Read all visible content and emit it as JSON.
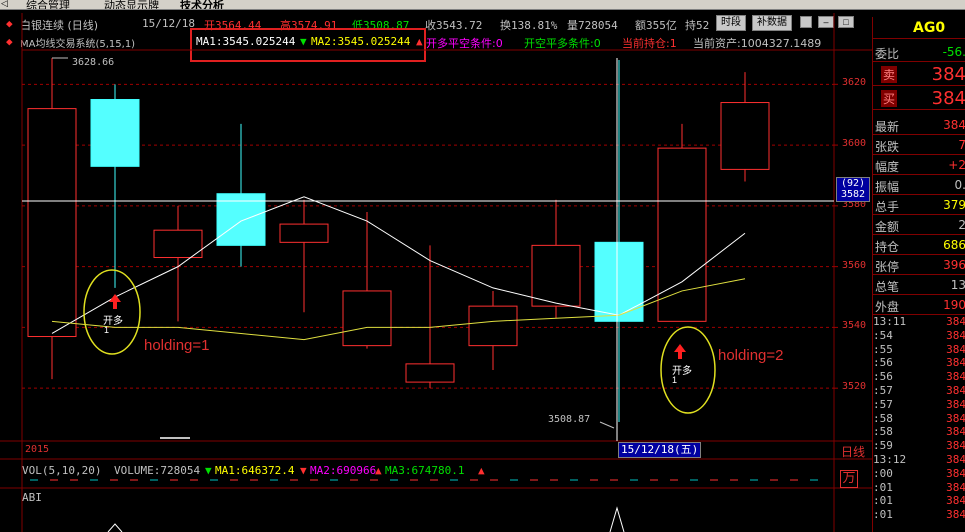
{
  "tabs": {
    "arrow": "◁",
    "items": [
      "综合管理",
      "动态显示牌",
      "技术分析"
    ],
    "active": 2
  },
  "header": {
    "title": "白银连续 (日线)",
    "date": "15/12/18",
    "open": "开3564.44",
    "high": "高3574.91",
    "low": "低3508.87",
    "close": "收3543.72",
    "turnover": "换138.81%",
    "volume": "量728054",
    "amount": "额355亿",
    "hold": "持52",
    "btn_time": "时段",
    "btn_data": "补数据"
  },
  "indicator": {
    "name": "MA均线交易系统(5,15,1)",
    "ma1": "MA1:3545.025244",
    "ma2": "MA2:3545.025244",
    "cond1": "开多平空条件:0",
    "cond2": "开空平多条件:0",
    "position": "当前持仓:1",
    "assets": "当前资产:1004327.1489"
  },
  "price_axis": {
    "labels": [
      "3620",
      "3600",
      "3580",
      "3560",
      "3540",
      "3520"
    ],
    "crosshair_tag_top": "(92)",
    "crosshair_tag_bottom": "3582"
  },
  "annotations": {
    "high_label": "3628.66",
    "low_label": "3508.87",
    "signal1": "开多",
    "signal1_sub": "1",
    "signal2": "开多",
    "signal2_sub": "1",
    "holding1": "holding=1",
    "holding2": "holding=2"
  },
  "x_axis": {
    "year": "2015",
    "cursor_date": "15/12/18(五)",
    "period": "日线"
  },
  "vol_panel": {
    "params": "VOL(5,10,20)",
    "volume": "VOLUME:728054",
    "ma1": "MA1:646372.4",
    "ma2": "MA2:690966",
    "ma3": "MA3:674780.1",
    "unit": "万"
  },
  "abi_panel": {
    "name": "ABI"
  },
  "right_panel": {
    "code": "AG0",
    "weibi_label": "委比",
    "weibi_value": "-56.",
    "sell_label": "卖",
    "sell_value": "384",
    "buy_label": "买",
    "buy_value": "384",
    "rows": [
      {
        "label": "最新",
        "value": "384",
        "color": "#ff3030"
      },
      {
        "label": "张跌",
        "value": "7",
        "color": "#ff3030"
      },
      {
        "label": "幅度",
        "value": "+2",
        "color": "#ff3030"
      },
      {
        "label": "振幅",
        "value": "0.",
        "color": "#c0c0c0"
      },
      {
        "label": "总手",
        "value": "379",
        "color": "#ffff00"
      },
      {
        "label": "金额",
        "value": "2",
        "color": "#c0c0c0"
      },
      {
        "label": "持仓",
        "value": "686",
        "color": "#ffff00"
      },
      {
        "label": "张停",
        "value": "396",
        "color": "#ff3030"
      },
      {
        "label": "总笔",
        "value": "13",
        "color": "#c0c0c0"
      },
      {
        "label": "外盘",
        "value": "190",
        "color": "#ff3030"
      }
    ],
    "ticks": [
      {
        "t": "13:11",
        "p": "384"
      },
      {
        "t": ":54",
        "p": "384"
      },
      {
        "t": ":55",
        "p": "384"
      },
      {
        "t": ":56",
        "p": "384"
      },
      {
        "t": ":56",
        "p": "384"
      },
      {
        "t": ":57",
        "p": "384"
      },
      {
        "t": ":57",
        "p": "384"
      },
      {
        "t": ":58",
        "p": "384"
      },
      {
        "t": ":58",
        "p": "384"
      },
      {
        "t": ":59",
        "p": "384"
      },
      {
        "t": "13:12",
        "p": "384"
      },
      {
        "t": ":00",
        "p": "384"
      },
      {
        "t": ":01",
        "p": "384"
      },
      {
        "t": ":01",
        "p": "384"
      },
      {
        "t": ":01",
        "p": "384"
      }
    ]
  },
  "chart_data": {
    "type": "candlestick",
    "price_range": [
      3508,
      3632
    ],
    "candles": [
      {
        "open": 3612,
        "close": 3537,
        "high": 3628.66,
        "low": 3523,
        "dir": "up"
      },
      {
        "open": 3615,
        "close": 3593,
        "high": 3620,
        "low": 3553,
        "dir": "down"
      },
      {
        "open": 3563,
        "close": 3572,
        "high": 3580,
        "low": 3542,
        "dir": "up"
      },
      {
        "open": 3584,
        "close": 3567,
        "high": 3607,
        "low": 3560,
        "dir": "down"
      },
      {
        "open": 3568,
        "close": 3574,
        "high": 3582,
        "low": 3545,
        "dir": "up"
      },
      {
        "open": 3534,
        "close": 3552,
        "high": 3578,
        "low": 3533,
        "dir": "up"
      },
      {
        "open": 3522,
        "close": 3528,
        "high": 3567,
        "low": 3520,
        "dir": "up"
      },
      {
        "open": 3534,
        "close": 3547,
        "high": 3552,
        "low": 3526,
        "dir": "up"
      },
      {
        "open": 3547,
        "close": 3567,
        "high": 3582,
        "low": 3543,
        "dir": "up"
      },
      {
        "open": 3568,
        "close": 3542,
        "high": 3628,
        "low": 3508.87,
        "dir": "down"
      },
      {
        "open": 3542,
        "close": 3599,
        "high": 3607,
        "low": 3548,
        "dir": "up"
      },
      {
        "open": 3592,
        "close": 3614,
        "high": 3624,
        "low": 3588,
        "dir": "up"
      }
    ],
    "ma_short": [
      3538,
      3550,
      3560,
      3575,
      3583,
      3575,
      3562,
      3553,
      3548,
      3544,
      3555,
      3571
    ],
    "ma_long": [
      3542,
      3540,
      3540,
      3538,
      3536,
      3540,
      3540,
      3542,
      3543,
      3544,
      3552,
      3556
    ],
    "volume_series": {
      "ma1": 646372.4,
      "ma2": 690966,
      "ma3": 674780.1,
      "last": 728054
    }
  }
}
